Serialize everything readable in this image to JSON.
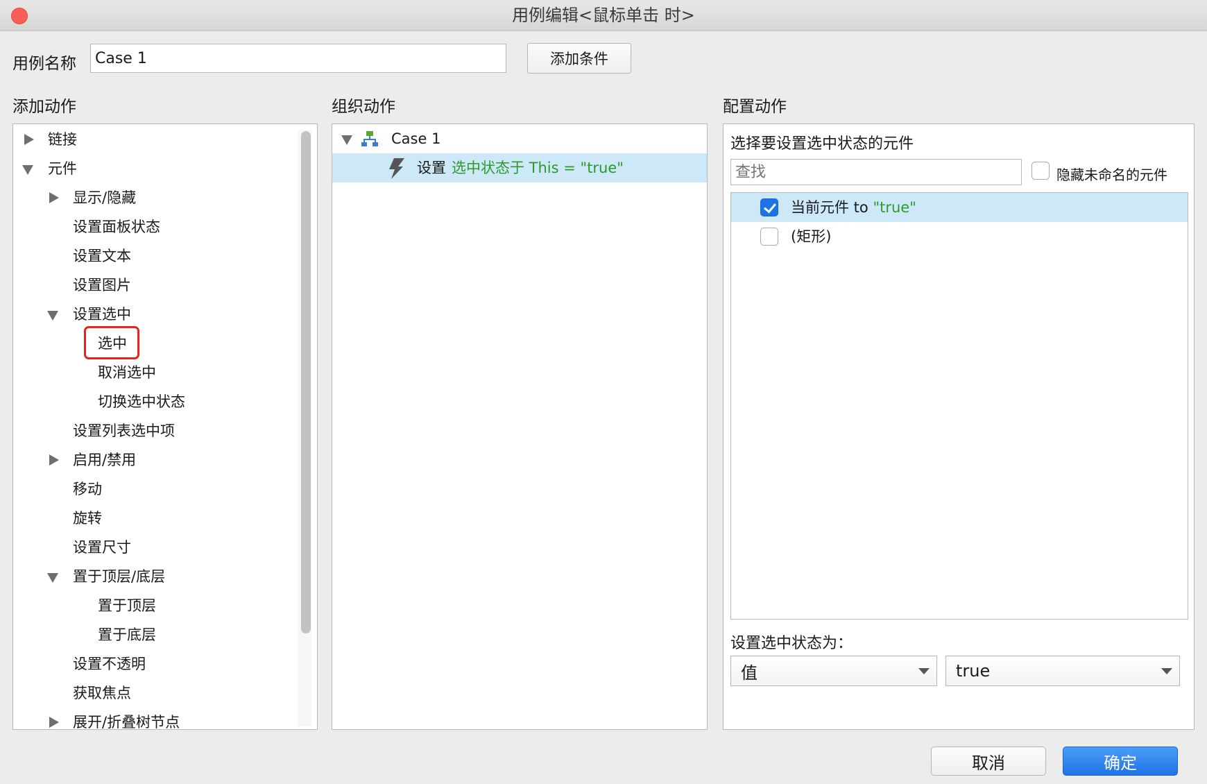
{
  "window": {
    "title": "用例编辑<鼠标单击 时>"
  },
  "case_name": {
    "label": "用例名称",
    "value": "Case 1",
    "add_condition_label": "添加条件"
  },
  "add_actions": {
    "title": "添加动作",
    "items": [
      {
        "label": "链接"
      },
      {
        "label": "元件"
      },
      {
        "label": "显示/隐藏"
      },
      {
        "label": "设置面板状态"
      },
      {
        "label": "设置文本"
      },
      {
        "label": "设置图片"
      },
      {
        "label": "设置选中"
      },
      {
        "label": "选中"
      },
      {
        "label": "取消选中"
      },
      {
        "label": "切换选中状态"
      },
      {
        "label": "设置列表选中项"
      },
      {
        "label": "启用/禁用"
      },
      {
        "label": "移动"
      },
      {
        "label": "旋转"
      },
      {
        "label": "设置尺寸"
      },
      {
        "label": "置于顶层/底层"
      },
      {
        "label": "置于顶层"
      },
      {
        "label": "置于底层"
      },
      {
        "label": "设置不透明"
      },
      {
        "label": "获取焦点"
      },
      {
        "label": "展开/折叠树节点"
      }
    ]
  },
  "organize": {
    "title": "组织动作",
    "case_label": "Case 1",
    "action_prefix": "设置",
    "action_detail": "选中状态于 This = \"true\""
  },
  "configure": {
    "title": "配置动作",
    "subtitle": "选择要设置选中状态的元件",
    "search_placeholder": "查找",
    "hide_unnamed_label": "隐藏未命名的元件",
    "widgets": [
      {
        "name": "当前元件",
        "suffix": " to ",
        "value": "\"true\"",
        "checked": true
      },
      {
        "name": "(矩形)",
        "suffix": "",
        "value": "",
        "checked": false
      }
    ],
    "set_state_label": "设置选中状态为：",
    "type_select": "值",
    "value_select": "true"
  },
  "footer": {
    "cancel_label": "取消",
    "ok_label": "确定"
  },
  "colors": {
    "accent": "#1e73e6",
    "highlight": "#cde8f6",
    "green_text": "#2b9a2b",
    "red_marker": "#e8231e"
  }
}
